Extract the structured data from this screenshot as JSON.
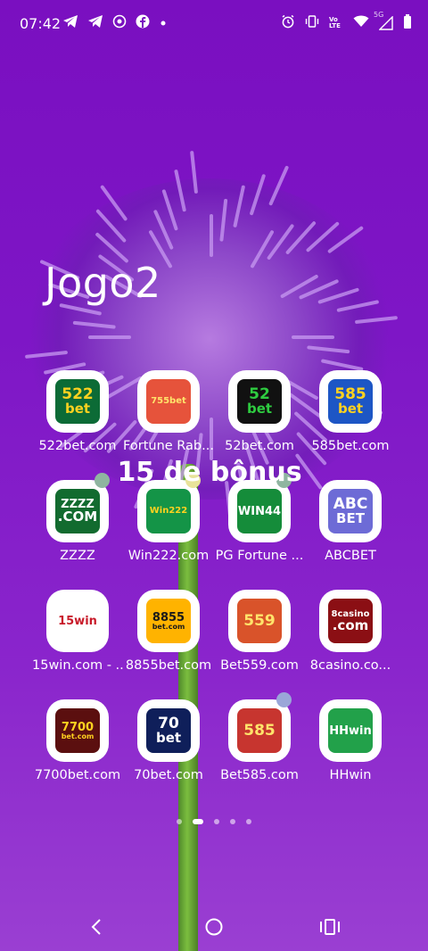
{
  "status_bar": {
    "time": "07:42",
    "left_icons": [
      "telegram-icon",
      "telegram-icon",
      "camera-icon",
      "facebook-icon",
      "dot-icon"
    ],
    "right_icons": [
      "alarm-icon",
      "vibrate-icon",
      "volte-icon",
      "wifi-icon",
      "signal-5g-icon",
      "battery-icon"
    ],
    "volte_text": "Vo LTE",
    "net_text": "5G"
  },
  "folder_title": "Jogo2",
  "banner_text": "15 de bônus",
  "apps": [
    {
      "label": "522bet.com",
      "logo": "522\nbet",
      "bg": "#0c6b36",
      "fg": "#ffd21f"
    },
    {
      "label": "Fortune Rab...",
      "logo": "755bet",
      "bg": "#e6533b",
      "fg": "#ffe46b"
    },
    {
      "label": "52bet.com",
      "logo": "52\nbet",
      "bg": "#111111",
      "fg": "#2ecc40"
    },
    {
      "label": "585bet.com",
      "logo": "585\nbet",
      "bg": "#1d56c5",
      "fg": "#ffd21f"
    },
    {
      "label": "ZZZZ",
      "logo": "ZZZZ\n.COM",
      "bg": "#126b2f",
      "fg": "#ffffff"
    },
    {
      "label": "Win222.com",
      "logo": "Win222",
      "bg": "#149447",
      "fg": "#ffd21f"
    },
    {
      "label": "PG Fortune ...",
      "logo": "WIN44",
      "bg": "#158c3a",
      "fg": "#ffffff"
    },
    {
      "label": "ABCBET",
      "logo": "ABC\nBET",
      "bg": "#6d6bd6",
      "fg": "#ffffff"
    },
    {
      "label": "15win.com - ...",
      "logo": "15win",
      "bg": "#ffffff",
      "fg": "#c81b2a"
    },
    {
      "label": "8855bet.com",
      "logo": "8855\nbet.com",
      "bg": "#ffb300",
      "fg": "#1a1a1a"
    },
    {
      "label": "Bet559.com",
      "logo": "559",
      "bg": "#d9532a",
      "fg": "#ffe46b"
    },
    {
      "label": "8casino.co...",
      "logo": "8casino\n.com",
      "bg": "#8b0f14",
      "fg": "#ffffff"
    },
    {
      "label": "7700bet.com",
      "logo": "7700\nbet.com",
      "bg": "#5b0f0f",
      "fg": "#ffd21f"
    },
    {
      "label": "70bet.com",
      "logo": "70\nbet",
      "bg": "#0f1f5a",
      "fg": "#ffffff"
    },
    {
      "label": "Bet585.com",
      "logo": "585",
      "bg": "#c7352f",
      "fg": "#ffe46b"
    },
    {
      "label": "HHwin",
      "logo": "HHwin",
      "bg": "#22a14a",
      "fg": "#ffffff"
    }
  ],
  "notification_dots": [
    {
      "app": "ZZZZ",
      "color": "#8fb5a0"
    },
    {
      "app": "Win222.com",
      "color": "#e8e39a"
    },
    {
      "app": "PG Fortune ...",
      "color": "#8fb5a0"
    },
    {
      "app": "Bet585.com",
      "color": "#9aa6d8"
    }
  ],
  "pager": {
    "count": 5,
    "active": 1
  },
  "navbar": {
    "back": "back-icon",
    "home": "home-icon",
    "recents": "recents-icon"
  }
}
